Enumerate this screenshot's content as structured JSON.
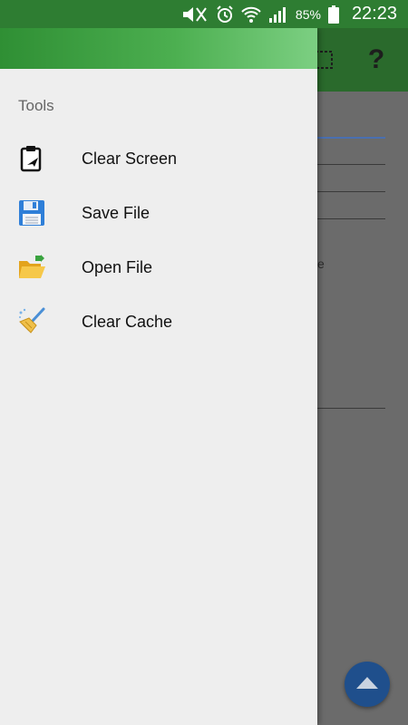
{
  "status_bar": {
    "battery_percent": "85%",
    "time": "22:23",
    "icons": [
      "mute-icon",
      "alarm-icon",
      "wifi-icon",
      "signal-icon",
      "battery-icon"
    ]
  },
  "drawer": {
    "section_title": "Tools",
    "items": [
      {
        "label": "Clear Screen",
        "icon": "clipboard-icon"
      },
      {
        "label": "Save File",
        "icon": "floppy-disk-icon"
      },
      {
        "label": "Open File",
        "icon": "open-folder-icon"
      },
      {
        "label": "Clear Cache",
        "icon": "broom-icon"
      }
    ]
  },
  "background_app": {
    "toolbar_icons": [
      "grid-icon",
      "help-icon"
    ],
    "help_glyph": "?",
    "text_fragment": "e",
    "fab_icon": "chevron-up-icon"
  },
  "colors": {
    "status_bar": "#2e7d32",
    "drawer_bg": "#eeeeee",
    "fab": "#1f4f8c"
  }
}
